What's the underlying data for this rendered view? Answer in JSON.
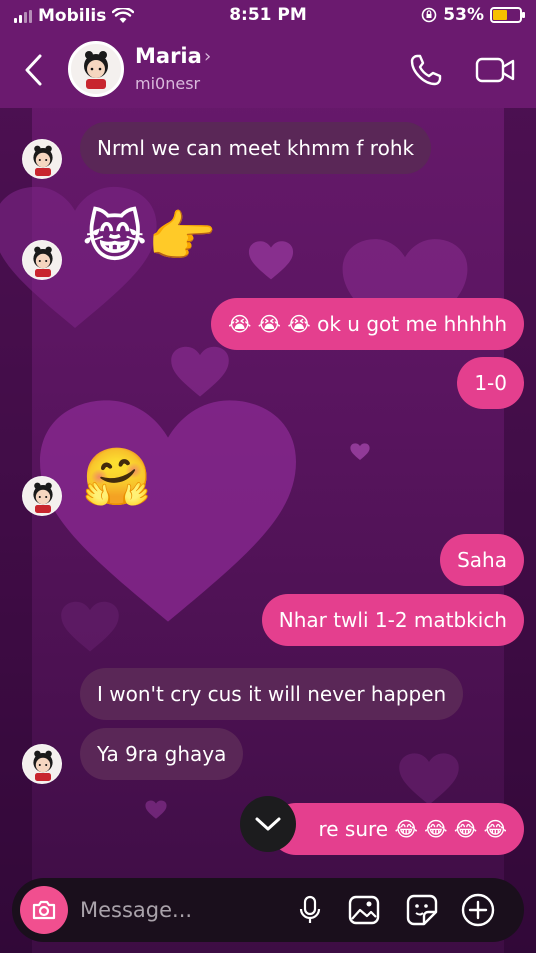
{
  "status_bar": {
    "carrier": "Mobilis",
    "time": "8:51 PM",
    "battery_percent": "53%",
    "battery_level": 0.53,
    "battery_color": "#f6c000"
  },
  "header": {
    "contact_name": "Maria",
    "contact_username": "mi0nesr",
    "icons": [
      "back-chevron-icon",
      "phone-icon",
      "video-camera-icon",
      "chevron-right-icon"
    ]
  },
  "messages": [
    {
      "side": "in",
      "text": "Nrml we can meet khmm f rohk",
      "avatar": true
    },
    {
      "side": "in",
      "emoji": "😹👉",
      "avatar": true
    },
    {
      "side": "out",
      "text": "😭 😭 😭 ok u got me hhhhh"
    },
    {
      "side": "out",
      "text": "1-0"
    },
    {
      "side": "in",
      "emoji": "🤗",
      "avatar": true
    },
    {
      "side": "out",
      "text": "Saha"
    },
    {
      "side": "out",
      "text": "Nhar twli 1-2 matbkich"
    },
    {
      "side": "in",
      "text": "I won't cry cus it will never happen",
      "avatar": false
    },
    {
      "side": "in",
      "text": "Ya 9ra ghaya",
      "avatar": true
    },
    {
      "side": "out",
      "text": "re sure 😂 😂 😂 😂"
    }
  ],
  "composer": {
    "placeholder": "Message...",
    "icons": [
      "camera-icon",
      "microphone-icon",
      "gallery-icon",
      "sticker-icon",
      "plus-circle-icon"
    ]
  },
  "colors": {
    "incoming_bubble": "#5a2757",
    "outgoing_bubble": "#e43f8e",
    "header_bg": "#6b1a6f",
    "camera_button": "#f14f8f"
  }
}
